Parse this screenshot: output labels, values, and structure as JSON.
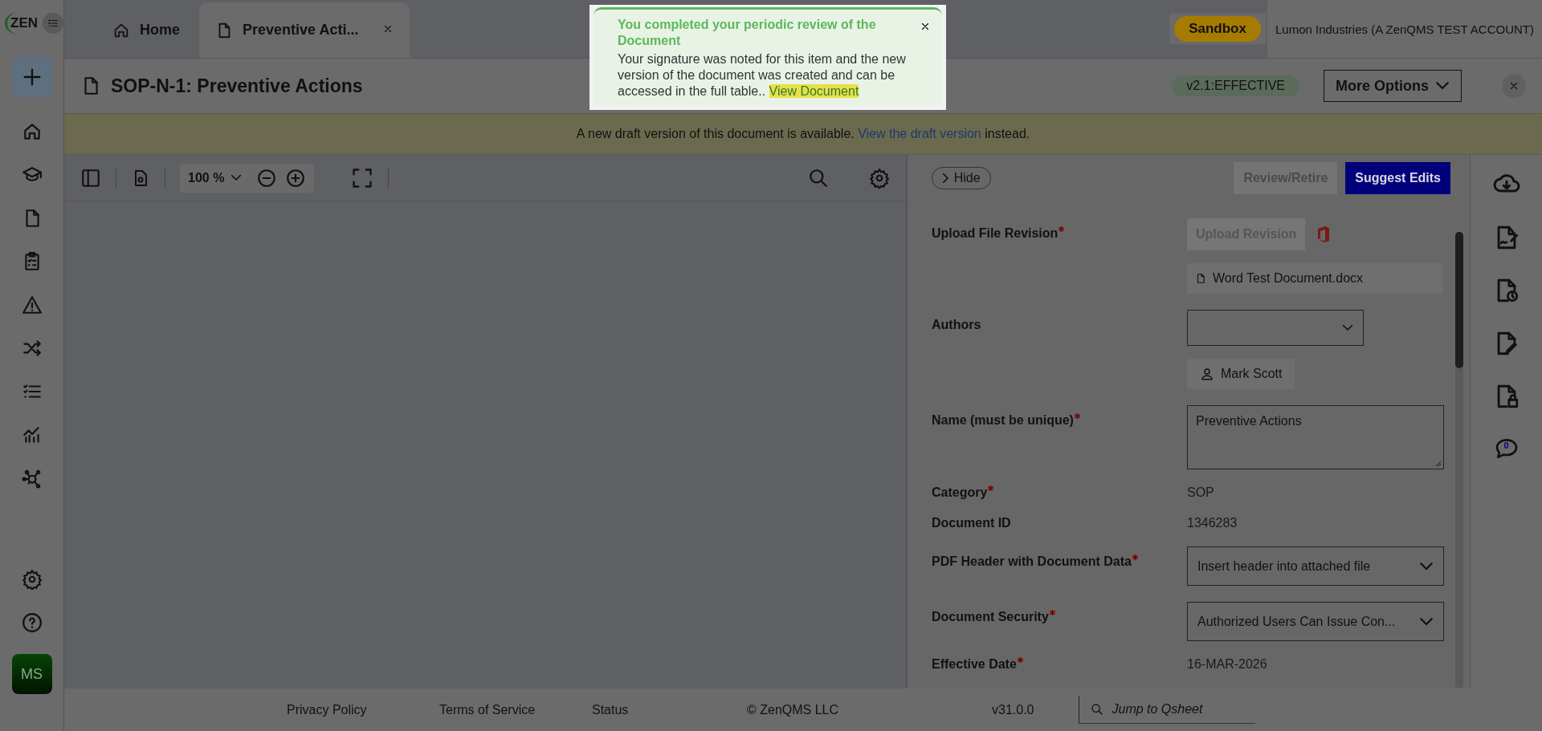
{
  "topbar": {
    "logo": "ZEN",
    "tabs": [
      {
        "label": "Home",
        "kind": "home",
        "selected": false,
        "closable": false
      },
      {
        "label": "Preventive Acti...",
        "kind": "record",
        "selected": true,
        "closable": true
      }
    ],
    "environment_badge": "Sandbox",
    "account": "Lumon Industries (A ZenQMS TEST ACCOUNT)"
  },
  "sidebar": {
    "avatar": "MS"
  },
  "document": {
    "title": "SOP-N-1: Preventive Actions",
    "status": "v2.1:EFFECTIVE",
    "more_options": "More Options"
  },
  "banner": {
    "text": "A new draft version of this document is available.",
    "link": "View the draft version",
    "after": "instead."
  },
  "viewer": {
    "zoom": "100 %"
  },
  "panel": {
    "hide": "Hide",
    "buttons": [
      {
        "label": "Review/Retire",
        "disabled": true
      },
      {
        "label": "Suggest Edits",
        "disabled": false
      }
    ],
    "fields": [
      {
        "kind": "upload",
        "label": "Upload File Revision",
        "required": true,
        "button": "Upload Revision",
        "file": "Word Test Document.docx"
      },
      {
        "kind": "authors",
        "label": "Authors",
        "required": false,
        "chips": [
          "Mark Scott"
        ]
      },
      {
        "kind": "textarea",
        "label": "Name (must be unique)",
        "required": true,
        "value": "Preventive Actions"
      },
      {
        "kind": "text",
        "label": "Category",
        "required": true,
        "value": "SOP"
      },
      {
        "kind": "text",
        "label": "Document ID",
        "required": false,
        "value": "1346283"
      },
      {
        "kind": "select",
        "label": "PDF Header with Document Data",
        "required": true,
        "value": "Insert header into attached file"
      },
      {
        "kind": "select",
        "label": "Document Security",
        "required": true,
        "value": "Authorized Users Can Issue Con..."
      },
      {
        "kind": "text",
        "label": "Effective Date",
        "required": true,
        "value": "16-MAR-2026"
      }
    ]
  },
  "comments_badge": "0",
  "footer": {
    "links": [
      "Privacy Policy",
      "Terms of Service",
      "Status"
    ],
    "copyright": "© ZenQMS LLC",
    "version": "v31.0.0",
    "search_placeholder": "Jump to Qsheet"
  },
  "toast": {
    "title": "You completed your periodic review of the Document",
    "message": "Your signature was noted for this item and the new version of the document was created and can be accessed in the full table..",
    "link": "View Document"
  }
}
